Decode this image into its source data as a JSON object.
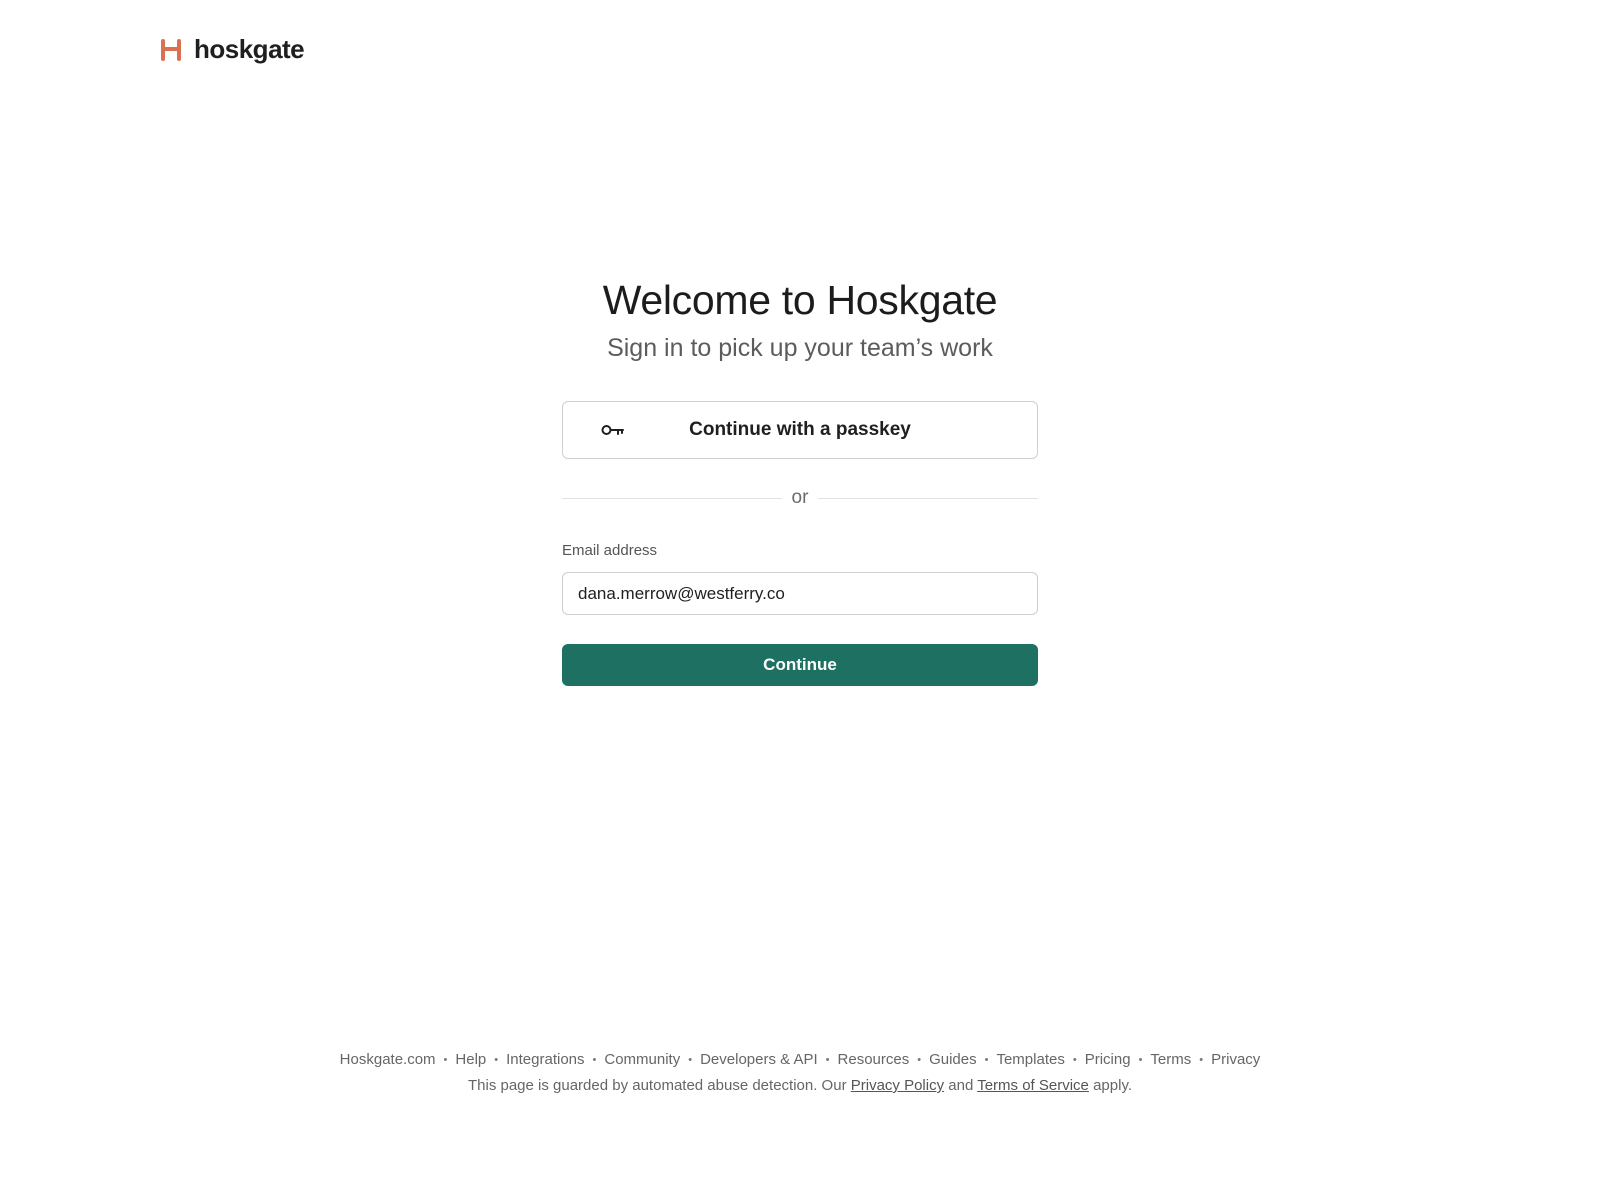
{
  "brand": {
    "name": "hoskgate",
    "logo_icon": "h-logo-icon",
    "accent_color": "#d9704f"
  },
  "main": {
    "title": "Welcome to Hoskgate",
    "subtitle": "Sign in to pick up your team’s work",
    "passkey_button": {
      "label": "Continue with a passkey",
      "icon": "key-icon"
    },
    "divider_text": "or",
    "email": {
      "label": "Email address",
      "value": "dana.merrow@westferry.co"
    },
    "continue_button": {
      "label": "Continue",
      "color": "#1e7162"
    }
  },
  "footer": {
    "links": [
      "Hoskgate.com",
      "Help",
      "Integrations",
      "Community",
      "Developers & API",
      "Resources",
      "Guides",
      "Templates",
      "Pricing",
      "Terms",
      "Privacy"
    ],
    "separator": "•",
    "legal": {
      "prefix": "This page is guarded by automated abuse detection. Our",
      "privacy_link": "Privacy Policy",
      "and": "and",
      "terms_link": "Terms of Service",
      "suffix": "apply."
    }
  }
}
